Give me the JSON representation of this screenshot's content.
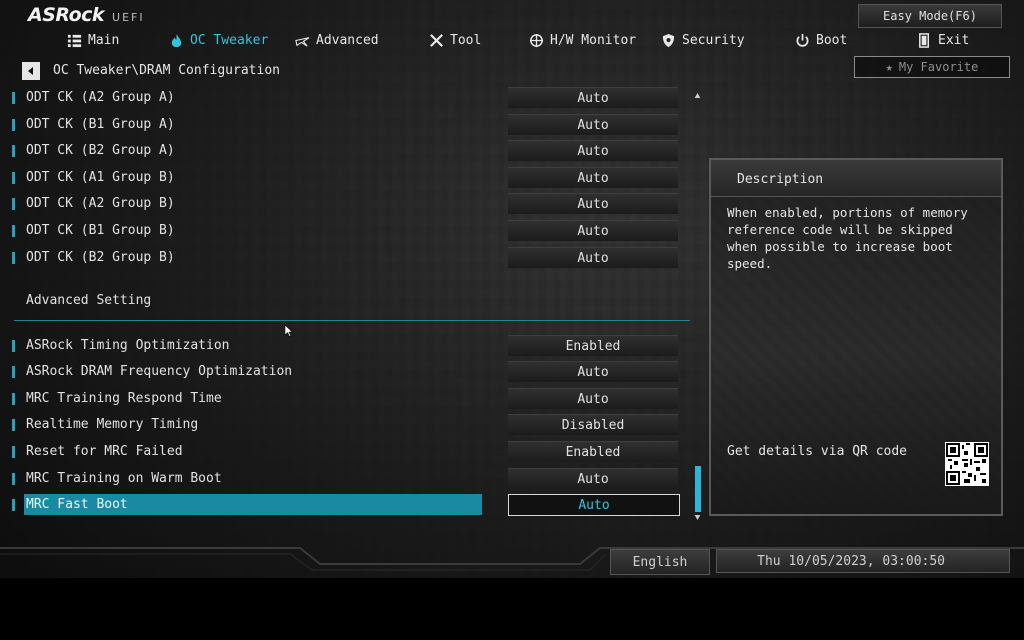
{
  "header": {
    "brand": "ASRock",
    "brand_sub": "UEFI",
    "easy_mode_label": "Easy Mode(F6)"
  },
  "nav": {
    "items": [
      {
        "label": "Main",
        "icon": "list-icon"
      },
      {
        "label": "OC Tweaker",
        "icon": "flame-icon",
        "active": true
      },
      {
        "label": "Advanced",
        "icon": "star-icon"
      },
      {
        "label": "Tool",
        "icon": "tools-icon"
      },
      {
        "label": "H/W Monitor",
        "icon": "crosshair-icon"
      },
      {
        "label": "Security",
        "icon": "shield-icon"
      },
      {
        "label": "Boot",
        "icon": "power-icon"
      },
      {
        "label": "Exit",
        "icon": "exit-door-icon"
      }
    ]
  },
  "breadcrumb": "OC Tweaker\\DRAM Configuration",
  "favorite_label": "My Favorite",
  "settings": {
    "odt_rows": [
      {
        "label": "ODT CK (A2 Group A)",
        "value": "Auto"
      },
      {
        "label": "ODT CK (B1 Group A)",
        "value": "Auto"
      },
      {
        "label": "ODT CK (B2 Group A)",
        "value": "Auto"
      },
      {
        "label": "ODT CK (A1 Group B)",
        "value": "Auto"
      },
      {
        "label": "ODT CK (A2 Group B)",
        "value": "Auto"
      },
      {
        "label": "ODT CK (B1 Group B)",
        "value": "Auto"
      },
      {
        "label": "ODT CK (B2 Group B)",
        "value": "Auto"
      }
    ],
    "section_title": "Advanced Setting",
    "advanced_rows": [
      {
        "label": "ASRock Timing Optimization",
        "value": "Enabled"
      },
      {
        "label": "ASRock DRAM Frequency Optimization",
        "value": "Auto"
      },
      {
        "label": "MRC Training Respond Time",
        "value": "Auto"
      },
      {
        "label": "Realtime Memory Timing",
        "value": "Disabled"
      },
      {
        "label": "Reset for MRC Failed",
        "value": "Enabled"
      },
      {
        "label": "MRC Training on Warm Boot",
        "value": "Auto"
      },
      {
        "label": "MRC Fast Boot",
        "value": "Auto",
        "selected": true
      }
    ]
  },
  "description": {
    "title": "Description",
    "text": "When enabled, portions of memory reference code will be skipped when possible to increase boot speed.",
    "qr_label": "Get details via QR code"
  },
  "footer": {
    "language": "English",
    "datetime": "Thu 10/05/2023, 03:00:50"
  },
  "colors": {
    "accent": "#2fc4e0",
    "selected_bar": "#1a8aa3",
    "marker": "#2a9fc0"
  }
}
